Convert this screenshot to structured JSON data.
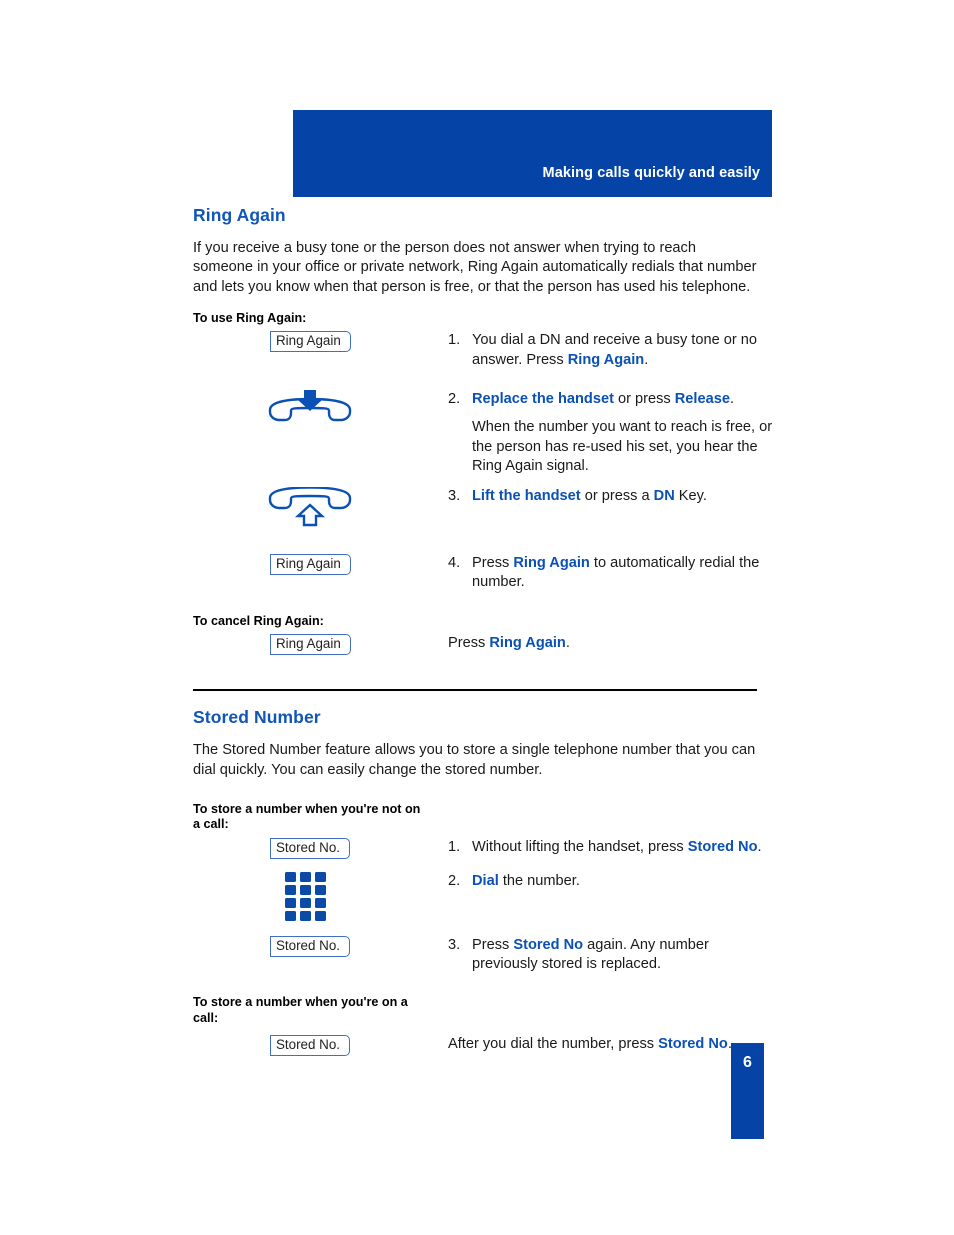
{
  "header": {
    "title": "Making calls quickly and easily"
  },
  "page": {
    "number": "6"
  },
  "sections": [
    {
      "title": "Ring Again",
      "intro": "If you receive a busy tone or the person does not answer when trying to reach someone in your office or private network, Ring Again automatically redials that number and lets you know when that person is free, or that the person has used his telephone.",
      "sub_heads": {
        "use": "To use Ring Again:",
        "cancel": "To cancel Ring Again:"
      },
      "keycaps": {
        "ring_again": "Ring Again"
      },
      "steps": [
        {
          "num": "1.",
          "text_before": "You dial a DN and receive a busy tone or no answer. Press ",
          "keyword": "Ring Again",
          "text_after": "."
        },
        {
          "num": "2.",
          "keyword": "Replace the handset",
          "text_middle": " or press ",
          "keyword2": "Release",
          "text_after": "."
        },
        {
          "num": "3.",
          "keyword": "Lift the handset",
          "text_middle": " or press a ",
          "keyword2": "DN",
          "text_after": " Key."
        },
        {
          "num": "4.",
          "text_before": "Press ",
          "keyword": "Ring Again",
          "text_after": " to automatically redial the number."
        }
      ],
      "note": "When the number you want to reach is free, or the person has re-used his set, you hear the Ring Again signal.",
      "cancel_step": {
        "text_before": "Press ",
        "keyword": "Ring Again",
        "text_after": "."
      },
      "icons": {
        "replace_handset": "handset-down-icon",
        "lift_handset": "handset-up-icon"
      }
    },
    {
      "title": "Stored Number",
      "intro": "The Stored Number feature allows you to store a single telephone number that you can dial quickly. You can easily change the stored number.",
      "sub_heads": {
        "not_on_call": "To store a number when you're not on a call:",
        "on_call": "To store a number when you're on a call:"
      },
      "keycaps": {
        "stored_no": "Stored No."
      },
      "steps": [
        {
          "num": "1.",
          "text_before": "Without lifting the handset, press ",
          "keyword": "Stored No",
          "text_after": "."
        },
        {
          "num": "2.",
          "keyword": "Dial",
          "text_after": " the number."
        },
        {
          "num": "3.",
          "text_before": "Press ",
          "keyword": "Stored No",
          "text_after": " again. Any number previously stored is replaced."
        }
      ],
      "on_call_step": {
        "text_before": "After  you dial the number, press ",
        "keyword": "Stored No",
        "text_after": "."
      },
      "icons": {
        "keypad": "dial-keypad-icon"
      }
    }
  ],
  "colors": {
    "brand_blue": "#0544a6",
    "heading_blue": "#1055b8",
    "keyword_blue": "#0b51b5"
  }
}
